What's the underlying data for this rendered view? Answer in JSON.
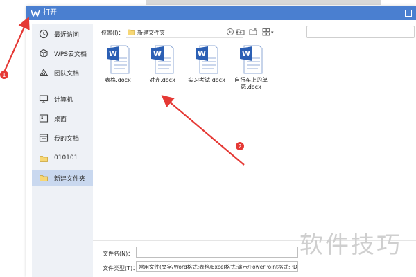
{
  "dialog": {
    "title": "打开",
    "icon": "wps-logo-icon"
  },
  "sidebar": {
    "items": [
      {
        "label": "最近访问",
        "icon": "clock-icon",
        "active": false
      },
      {
        "label": "WPS云文档",
        "icon": "cloud-cube-icon",
        "active": false
      },
      {
        "label": "团队文档",
        "icon": "team-icon",
        "active": false
      },
      {
        "label": "计算机",
        "icon": "monitor-icon",
        "active": false
      },
      {
        "label": "桌面",
        "icon": "desktop-icon",
        "active": false
      },
      {
        "label": "我的文档",
        "icon": "documents-icon",
        "active": false
      },
      {
        "label": "010101",
        "icon": "folder-icon",
        "active": false
      },
      {
        "label": "新建文件夹",
        "icon": "folder-icon",
        "active": true
      }
    ]
  },
  "toolbar": {
    "location_label": "位置(I)：",
    "path": "新建文件夹",
    "dropdown_glyph": "▾",
    "back_glyph": "⊖"
  },
  "files": [
    {
      "name": "表格.docx"
    },
    {
      "name": "对齐.docx"
    },
    {
      "name": "实习考试.docx"
    },
    {
      "name": "自行车上的单恋.docx"
    }
  ],
  "footer": {
    "filename_label": "文件名(N)：",
    "filename_value": "",
    "filetype_label": "文件类型(T)：",
    "filetype_value": "常用文件(文字/Word格式;表格/Excel格式;演示/PowerPoint格式;PDF"
  },
  "annotations": {
    "marker_1": "1",
    "marker_2": "2",
    "arrow_color": "#e53935"
  },
  "watermark": "软件技巧",
  "colors": {
    "titlebar": "#4a7fd0",
    "sidebar_bg": "#eef1f6",
    "sidebar_active": "#c9d8ef",
    "word_blue": "#2b5fb4"
  }
}
